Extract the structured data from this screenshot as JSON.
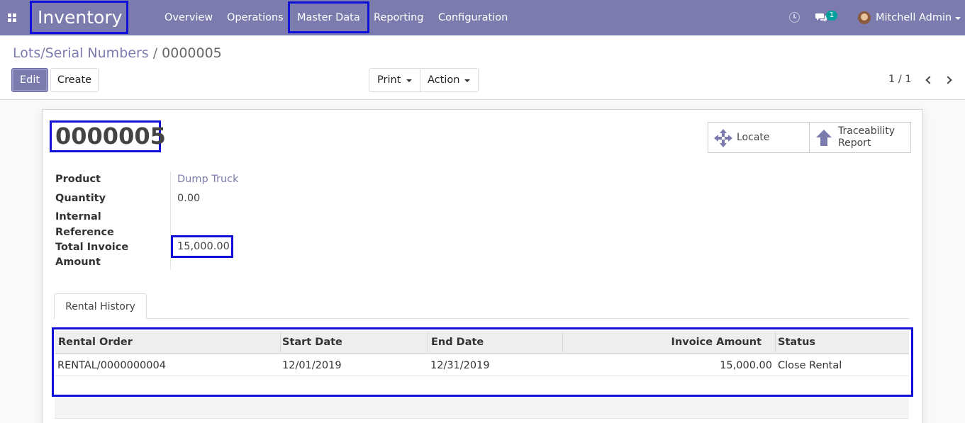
{
  "navbar": {
    "app_name": "Inventory",
    "menu": [
      "Overview",
      "Operations",
      "Master Data",
      "Reporting",
      "Configuration"
    ],
    "chat_count": "1",
    "user_name": "Mitchell Admin"
  },
  "breadcrumb": {
    "parent": "Lots/Serial Numbers",
    "separator": "/",
    "current": "0000005"
  },
  "buttons": {
    "edit": "Edit",
    "create": "Create",
    "print": "Print",
    "action": "Action"
  },
  "pager": "1 / 1",
  "record": {
    "name": "0000005",
    "fields": {
      "product_label": "Product",
      "product_value": "Dump Truck",
      "quantity_label": "Quantity",
      "quantity_value": "0.00",
      "internal_ref_label_1": "Internal",
      "internal_ref_label_2": "Reference",
      "total_invoice_label_1": "Total Invoice",
      "total_invoice_label_2": "Amount",
      "total_invoice_value": "15,000.00"
    }
  },
  "smart_buttons": {
    "locate": "Locate",
    "trace_1": "Traceability",
    "trace_2": "Report"
  },
  "tabs": [
    "Rental History"
  ],
  "rental_table": {
    "columns": [
      "Rental Order",
      "Start Date",
      "End Date",
      "Invoice Amount",
      "Status"
    ],
    "rows": [
      [
        "RENTAL/0000000004",
        "12/01/2019",
        "12/31/2019",
        "15,000.00",
        "Close Rental"
      ]
    ]
  },
  "colors": {
    "brand": "#7c7bad",
    "highlight": "#1010d8"
  }
}
